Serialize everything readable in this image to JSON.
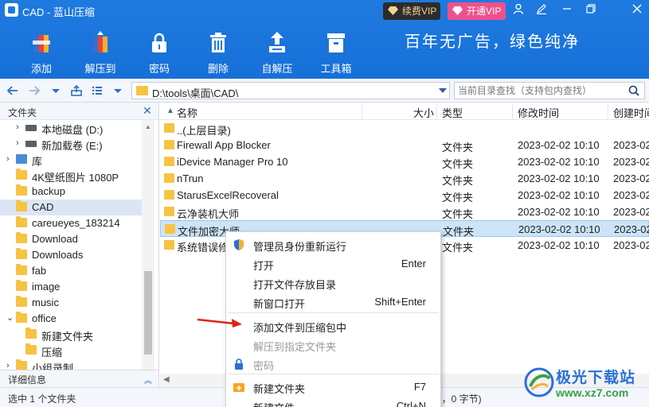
{
  "window": {
    "title": "CAD - 蓝山压缩",
    "controls": [
      "user-icon",
      "edit-icon",
      "minimize-icon",
      "close-icon"
    ]
  },
  "vip": {
    "renew_label": "续费VIP",
    "open_label": "开通VIP"
  },
  "toolbar": {
    "items": [
      {
        "label": "添加",
        "icon": "add-archive-icon"
      },
      {
        "label": "解压到",
        "icon": "extract-icon"
      },
      {
        "label": "密码",
        "icon": "password-lock-icon"
      },
      {
        "label": "删除",
        "icon": "delete-trash-icon"
      },
      {
        "label": "自解压",
        "icon": "self-extract-icon"
      },
      {
        "label": "工具箱",
        "icon": "toolbox-icon"
      }
    ],
    "slogan": "百年无广告，绿色纯净"
  },
  "address": {
    "path": "D:\\tools\\桌面\\CAD\\",
    "search_placeholder": "当前目录查找（支持包内查找）"
  },
  "left_panel": {
    "title": "文件夹",
    "tree": [
      {
        "label": "本地磁盘 (D:)",
        "icon": "disk",
        "indent": 1,
        "arrow": "›"
      },
      {
        "label": "新加载卷 (E:)",
        "icon": "disk",
        "indent": 1,
        "arrow": "›"
      },
      {
        "label": "库",
        "icon": "lib",
        "indent": 0,
        "arrow": "›"
      },
      {
        "label": "4K壁纸图片 1080P",
        "icon": "folder",
        "indent": 0,
        "arrow": ""
      },
      {
        "label": "backup",
        "icon": "folder",
        "indent": 0,
        "arrow": ""
      },
      {
        "label": "CAD",
        "icon": "folder",
        "indent": 0,
        "arrow": "",
        "selected": true
      },
      {
        "label": "careueyes_183214",
        "icon": "folder",
        "indent": 0,
        "arrow": ""
      },
      {
        "label": "Download",
        "icon": "folder",
        "indent": 0,
        "arrow": ""
      },
      {
        "label": "Downloads",
        "icon": "folder",
        "indent": 0,
        "arrow": ""
      },
      {
        "label": "fab",
        "icon": "folder",
        "indent": 0,
        "arrow": ""
      },
      {
        "label": "image",
        "icon": "folder",
        "indent": 0,
        "arrow": ""
      },
      {
        "label": "music",
        "icon": "folder",
        "indent": 0,
        "arrow": ""
      },
      {
        "label": "office",
        "icon": "folder",
        "indent": 0,
        "arrow": "⌄"
      },
      {
        "label": "新建文件夹",
        "icon": "folder",
        "indent": 1,
        "arrow": ""
      },
      {
        "label": "压缩",
        "icon": "folder",
        "indent": 1,
        "arrow": ""
      },
      {
        "label": "小组录制",
        "icon": "folder",
        "indent": 0,
        "arrow": "›"
      }
    ],
    "detail_label": "详细信息"
  },
  "file_list": {
    "columns": {
      "name": "名称",
      "size": "大小",
      "type": "类型",
      "modified": "修改时间",
      "created": "创建时间"
    },
    "rows": [
      {
        "name": "..(上层目录)",
        "type": "",
        "modified": "",
        "created": ""
      },
      {
        "name": "Firewall App Blocker",
        "type": "文件夹",
        "modified": "2023-02-02 10:10",
        "created": "2023-02"
      },
      {
        "name": "iDevice Manager Pro 10",
        "type": "文件夹",
        "modified": "2023-02-02 10:10",
        "created": "2023-02"
      },
      {
        "name": "nTrun",
        "type": "文件夹",
        "modified": "2023-02-02 10:10",
        "created": "2023-02"
      },
      {
        "name": "StarusExcelRecoveral",
        "type": "文件夹",
        "modified": "2023-02-02 10:10",
        "created": "2023-02"
      },
      {
        "name": "云净装机大师",
        "type": "文件夹",
        "modified": "2023-02-02 10:10",
        "created": "2023-02"
      },
      {
        "name": "文件加密大师",
        "type": "文件夹",
        "modified": "2023-02-02 10:10",
        "created": "2023-02",
        "selected": true
      },
      {
        "name": "系统错误修",
        "type": "文件夹",
        "modified": "2023-02-02 10:10",
        "created": "2023-02"
      }
    ]
  },
  "context_menu": {
    "items": [
      {
        "label": "管理员身份重新运行",
        "key": "",
        "icon": "shield-icon",
        "disabled": false
      },
      {
        "label": "打开",
        "key": "Enter",
        "icon": "",
        "disabled": false
      },
      {
        "label": "打开文件存放目录",
        "key": "",
        "icon": "",
        "disabled": false
      },
      {
        "label": "新窗口打开",
        "key": "Shift+Enter",
        "icon": "",
        "disabled": false
      },
      {
        "label": "添加文件到压缩包中",
        "key": "",
        "icon": "",
        "disabled": false
      },
      {
        "label": "解压到指定文件夹",
        "key": "",
        "icon": "",
        "disabled": true
      },
      {
        "label": "密码",
        "key": "",
        "icon": "lock-icon",
        "disabled": true
      },
      {
        "label": "新建文件夹",
        "key": "F7",
        "icon": "new-folder-icon",
        "disabled": false
      },
      {
        "label": "新建文件",
        "key": "Ctrl+N",
        "icon": "",
        "disabled": false
      }
    ]
  },
  "status": {
    "left": "选中 1 个文件夹",
    "right": "3，0 字节)"
  },
  "watermark": {
    "name": "极光下载站",
    "url": "www.xz7.com"
  },
  "colors": {
    "accent": "#1f7ae0",
    "selection": "#cce4f7",
    "folder": "#f6c342",
    "vip_pink": "#f0508d"
  }
}
